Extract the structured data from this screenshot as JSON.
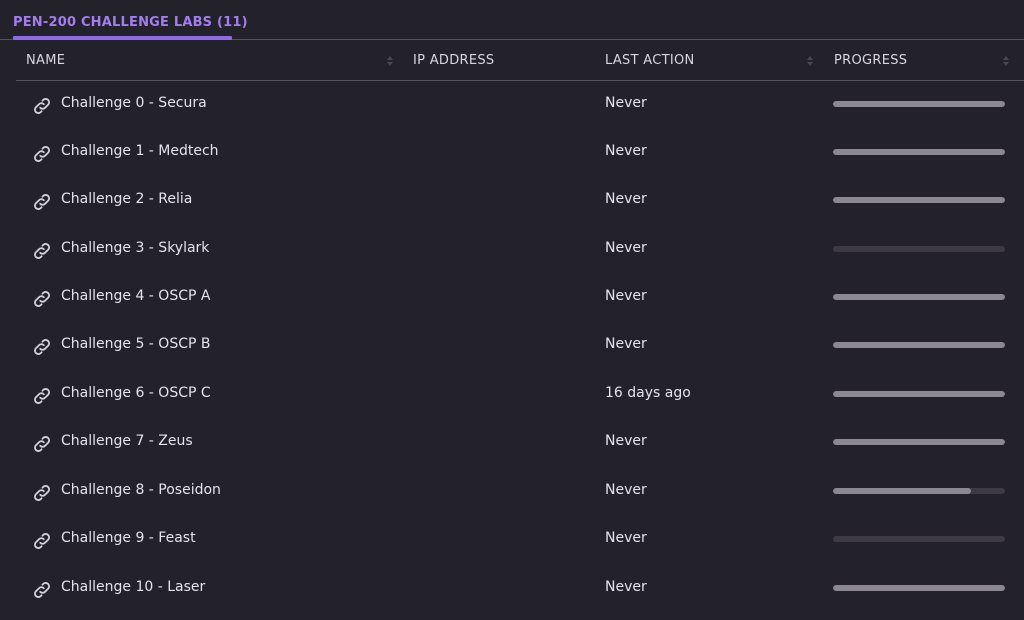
{
  "tab": {
    "label": "PEN-200 CHALLENGE LABS (11)"
  },
  "table": {
    "columns": [
      {
        "label": "NAME",
        "sortable": true
      },
      {
        "label": "IP ADDRESS",
        "sortable": false
      },
      {
        "label": "LAST ACTION",
        "sortable": true
      },
      {
        "label": "PROGRESS",
        "sortable": true
      }
    ],
    "rows": [
      {
        "name": "Challenge 0 - Secura",
        "ip": "",
        "last_action": "Never",
        "progress": 1.0
      },
      {
        "name": "Challenge 1 - Medtech",
        "ip": "",
        "last_action": "Never",
        "progress": 1.0
      },
      {
        "name": "Challenge 2 - Relia",
        "ip": "",
        "last_action": "Never",
        "progress": 1.0
      },
      {
        "name": "Challenge 3 - Skylark",
        "ip": "",
        "last_action": "Never",
        "progress": 0.0
      },
      {
        "name": "Challenge 4 - OSCP A",
        "ip": "",
        "last_action": "Never",
        "progress": 1.0
      },
      {
        "name": "Challenge 5 - OSCP B",
        "ip": "",
        "last_action": "Never",
        "progress": 1.0
      },
      {
        "name": "Challenge 6 - OSCP C",
        "ip": "",
        "last_action": "16 days ago",
        "progress": 1.0
      },
      {
        "name": "Challenge 7 - Zeus",
        "ip": "",
        "last_action": "Never",
        "progress": 1.0
      },
      {
        "name": "Challenge 8 - Poseidon",
        "ip": "",
        "last_action": "Never",
        "progress": 0.8
      },
      {
        "name": "Challenge 9 - Feast",
        "ip": "",
        "last_action": "Never",
        "progress": 0.0
      },
      {
        "name": "Challenge 10 - Laser",
        "ip": "",
        "last_action": "Never",
        "progress": 1.0
      }
    ],
    "row_icon": "link-icon"
  },
  "colors": {
    "background": "#23212a",
    "accent": "#a27ef0",
    "progress_fill": "#8b8891",
    "progress_track": "#3d3a44",
    "divider": "#55525d"
  }
}
